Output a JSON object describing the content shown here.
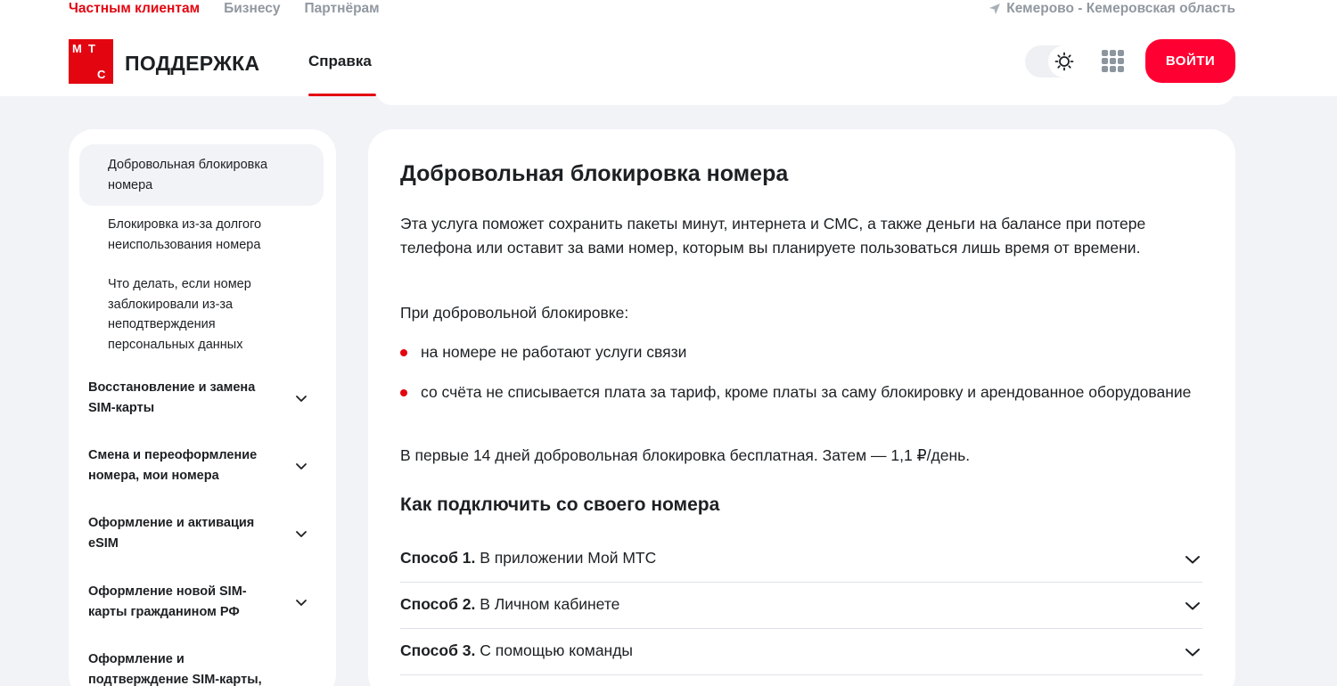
{
  "segments": [
    "Частным клиентам",
    "Бизнесу",
    "Партнёрам"
  ],
  "region": "Кемерово - Кемеровская область",
  "logo": {
    "m": "М",
    "t": "Т",
    "s": "С"
  },
  "brand": "ПОДДЕРЖКА",
  "nav": {
    "help": "Справка"
  },
  "login_label": "ВОЙТИ",
  "colors": {
    "accent": "#e30611",
    "login": "#ff0032"
  },
  "sidebar": {
    "items": [
      "Добровольная блокировка номера",
      "Блокировка из-за долгого неиспользования номера",
      "Что делать, если номер заблокировали из-за неподтверждения персональных данных"
    ],
    "groups": [
      "Восстановление и замена SIM-карты",
      "Смена и переоформление номера, мои номера",
      "Оформление и активация eSIM",
      "Оформление новой SIM-карты гражданином РФ",
      "Оформление и подтверждение SIM-карты,"
    ]
  },
  "article": {
    "title": "Добровольная блокировка номера",
    "intro": "Эта услуга поможет сохранить пакеты минут, интернета и СМС, а также деньги на балансе при потере телефона или оставит за вами номер, которым вы планируете пользоваться лишь время от времени.",
    "during": "При добровольной блокировке:",
    "bullets": [
      "на номере не работают услуги связи",
      "со счёта не списывается плата за тариф, кроме платы за саму блокировку и арендованное оборудование"
    ],
    "price": "В первые 14 дней добровольная блокировка бесплатная. Затем — 1,1 ₽/день.",
    "how_title": "Как подключить со своего номера",
    "methods": [
      {
        "label": "Способ 1.",
        "text": "В приложении Мой МТС"
      },
      {
        "label": "Способ 2.",
        "text": "В Личном кабинете"
      },
      {
        "label": "Способ 3.",
        "text": "С помощью команды"
      }
    ]
  }
}
